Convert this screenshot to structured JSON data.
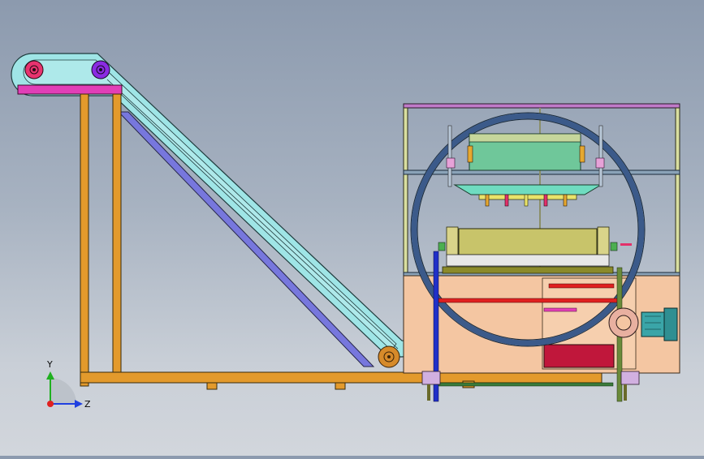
{
  "triad": {
    "y_label": "Y",
    "z_label": "Z"
  },
  "colors": {
    "background_top": "#8c9aae",
    "background_bottom": "#d2d6dc",
    "frame_orange": "#e39a2c",
    "belt_cyan": "#9fe5e6",
    "belt_outline": "#1f3b3d",
    "conveyor_blue": "#7777dd",
    "magenta_plate": "#e13fb7",
    "pulley_red": "#e8336f",
    "pulley_purple": "#8a2be2",
    "machine_body": "#f4c6a2",
    "ring_blue": "#3b5a8a",
    "mold_green": "#6fc79a",
    "press_olive": "#c8c46a",
    "motor_teal": "#3aa5a8",
    "hopper_crimson": "#c0173b",
    "axis_red": "#e02020",
    "axis_green": "#20b020",
    "axis_blue": "#2040e0"
  },
  "icons": {
    "axis_triad": "coordinate-axes-icon"
  }
}
